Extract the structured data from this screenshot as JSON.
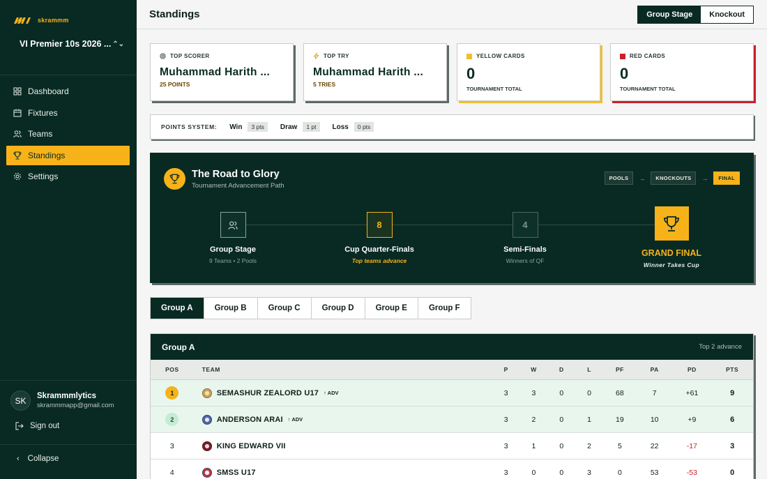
{
  "brand": {
    "name": "skrammm"
  },
  "tournament": {
    "name": "VI Premier 10s 2026 ..."
  },
  "nav": [
    {
      "label": "Dashboard",
      "icon": "dashboard-icon"
    },
    {
      "label": "Fixtures",
      "icon": "calendar-icon"
    },
    {
      "label": "Teams",
      "icon": "users-icon"
    },
    {
      "label": "Standings",
      "icon": "trophy-icon",
      "active": true
    },
    {
      "label": "Settings",
      "icon": "gear-icon"
    }
  ],
  "user": {
    "initials": "SK",
    "name": "Skrammmlytics",
    "email": "skrammmapp@gmail.com"
  },
  "signout_label": "Sign out",
  "collapse_label": "Collapse",
  "header": {
    "title": "Standings",
    "stage_tabs": [
      "Group Stage",
      "Knockout"
    ],
    "active_stage": "Group Stage"
  },
  "stats": {
    "top_scorer": {
      "label": "TOP SCORER",
      "name": "Muhammad Harith ...",
      "sub": "25 POINTS"
    },
    "top_try": {
      "label": "TOP TRY",
      "name": "Muhammad Harith ...",
      "sub": "5 TRIES"
    },
    "yellow": {
      "label": "YELLOW CARDS",
      "value": "0",
      "sub": "TOURNAMENT TOTAL",
      "color": "#f2be2e"
    },
    "red": {
      "label": "RED CARDS",
      "value": "0",
      "sub": "TOURNAMENT TOTAL",
      "color": "#c8202c"
    }
  },
  "points_system": {
    "title": "POINTS SYSTEM:",
    "win_label": "Win",
    "win_value": "3 pts",
    "draw_label": "Draw",
    "draw_value": "1 pt",
    "loss_label": "Loss",
    "loss_value": "0 pts"
  },
  "road": {
    "title": "The Road to Glory",
    "subtitle": "Tournament Advancement Path",
    "path": [
      "POOLS",
      "KNOCKOUTS",
      "FINAL"
    ],
    "stages": [
      {
        "name": "Group Stage",
        "desc": "9 Teams • 2 Pools",
        "badge": ""
      },
      {
        "name": "Cup Quarter-Finals",
        "desc": "Top teams advance",
        "badge": "8"
      },
      {
        "name": "Semi-Finals",
        "desc": "Winners of QF",
        "badge": "4"
      },
      {
        "name": "GRAND FINAL",
        "desc": "Winner Takes Cup",
        "badge": ""
      }
    ]
  },
  "groups": [
    "Group A",
    "Group B",
    "Group C",
    "Group D",
    "Group E",
    "Group F"
  ],
  "active_group": "Group A",
  "table": {
    "group_name": "Group A",
    "advance_note": "Top 2 advance",
    "columns": [
      "POS",
      "TEAM",
      "P",
      "W",
      "D",
      "L",
      "PF",
      "PA",
      "PD",
      "PTS"
    ],
    "adv_tag": "↑ ADV",
    "rows": [
      {
        "pos": "1",
        "team": "SEMASHUR ZEALORD U17",
        "adv": true,
        "p": "3",
        "w": "3",
        "d": "0",
        "l": "0",
        "pf": "68",
        "pa": "7",
        "pd": "+61",
        "pts": "9",
        "crest": "#c9a45a"
      },
      {
        "pos": "2",
        "team": "ANDERSON ARAI",
        "adv": true,
        "p": "3",
        "w": "2",
        "d": "0",
        "l": "1",
        "pf": "19",
        "pa": "10",
        "pd": "+9",
        "pts": "6",
        "crest": "#5566a8"
      },
      {
        "pos": "3",
        "team": "KING EDWARD VII",
        "adv": false,
        "p": "3",
        "w": "1",
        "d": "0",
        "l": "2",
        "pf": "5",
        "pa": "22",
        "pd": "-17",
        "pts": "3",
        "crest": "#7a1f2b"
      },
      {
        "pos": "4",
        "team": "SMSS U17",
        "adv": false,
        "p": "3",
        "w": "0",
        "d": "0",
        "l": "3",
        "pf": "0",
        "pa": "53",
        "pd": "-53",
        "pts": "0",
        "crest": "#c23b3b"
      }
    ]
  },
  "colors": {
    "primary": "#082a22",
    "accent": "#f7b21a",
    "danger": "#c8202c"
  }
}
